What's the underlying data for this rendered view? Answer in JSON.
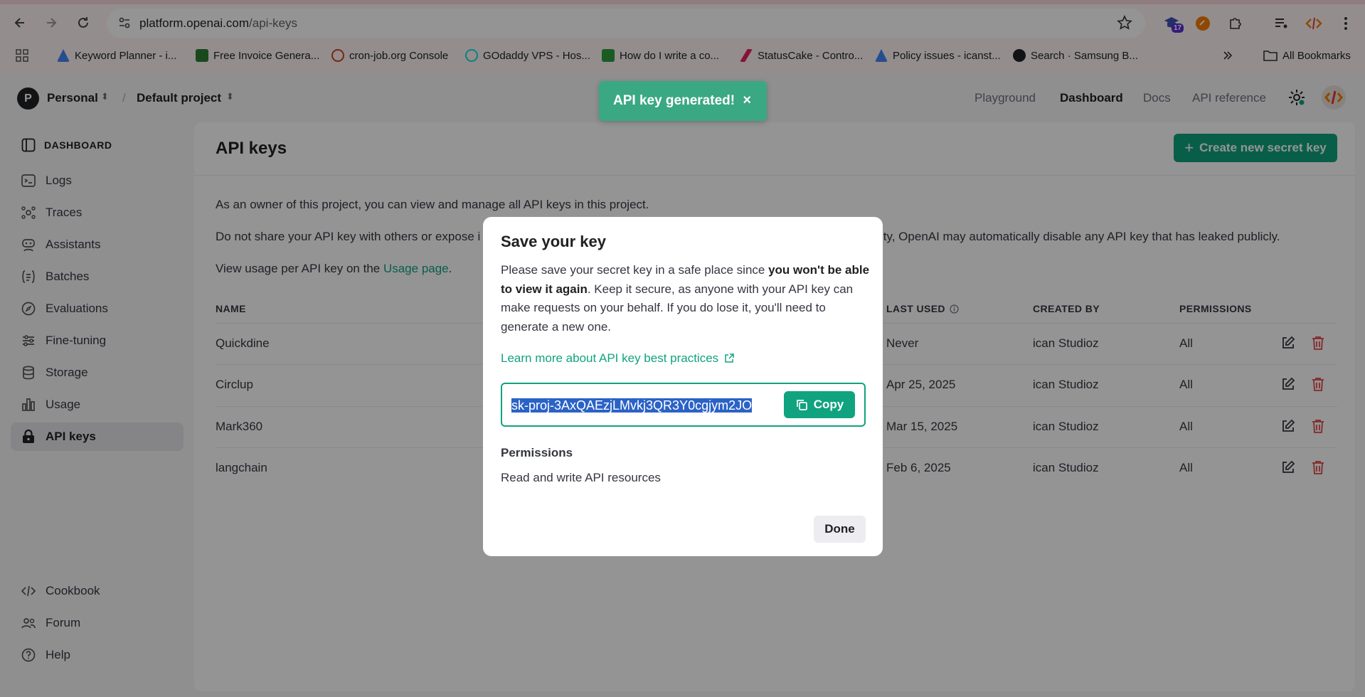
{
  "browser": {
    "url_host": "platform.openai.com",
    "url_path": "/api-keys",
    "extension_badge": "17",
    "bookmarks": [
      {
        "label": "Keyword Planner - i...",
        "color": "#4285f4"
      },
      {
        "label": "Free Invoice Genera...",
        "color": "#2e7d32"
      },
      {
        "label": "cron-job.org Console",
        "color": "#d84315"
      },
      {
        "label": "GOdaddy VPS - Hos...",
        "color": "#1bdbdb"
      },
      {
        "label": "How do I write a co...",
        "color": "#2e9e3e"
      },
      {
        "label": "StatusCake - Contro...",
        "color": "#e91e63"
      },
      {
        "label": "Policy issues - icanst...",
        "color": "#4285f4"
      },
      {
        "label": "Search · Samsung B...",
        "color": "#202124"
      }
    ],
    "all_bookmarks": "All Bookmarks"
  },
  "header": {
    "org_initial": "P",
    "org_name": "Personal",
    "separator": "/",
    "project_name": "Default project",
    "nav": [
      "Playground",
      "Dashboard",
      "Docs",
      "API reference"
    ]
  },
  "sidebar": {
    "heading": "DASHBOARD",
    "items": [
      "Logs",
      "Traces",
      "Assistants",
      "Batches",
      "Evaluations",
      "Fine-tuning",
      "Storage",
      "Usage",
      "API keys"
    ],
    "footer": [
      "Cookbook",
      "Forum",
      "Help"
    ]
  },
  "page": {
    "title": "API keys",
    "create_button": "Create new secret key",
    "line1": "As an owner of this project, you can view and manage all API keys in this project.",
    "line2_start": "Do not share your API key with others or expose i",
    "line2_end": "ity, OpenAI may automatically disable any API key that has leaked publicly.",
    "line3_prefix": "View usage per API key on the ",
    "line3_link": "Usage page",
    "line3_suffix": "."
  },
  "table": {
    "headers": {
      "name": "NAME",
      "last_used": "LAST USED",
      "created_by": "CREATED BY",
      "permissions": "PERMISSIONS"
    },
    "rows": [
      {
        "name": "Quickdine",
        "last_used": "Never",
        "created_by": "ican Studioz",
        "permissions": "All"
      },
      {
        "name": "Circlup",
        "last_used": "Apr 25, 2025",
        "created_by": "ican Studioz",
        "permissions": "All"
      },
      {
        "name": "Mark360",
        "last_used": "Mar 15, 2025",
        "created_by": "ican Studioz",
        "permissions": "All"
      },
      {
        "name": "langchain",
        "last_used": "Feb 6, 2025",
        "created_by": "ican Studioz",
        "permissions": "All"
      }
    ]
  },
  "toast": {
    "message": "API key generated!",
    "close": "×"
  },
  "modal": {
    "title": "Save your key",
    "text_start": "Please save your secret key in a safe place since ",
    "text_bold": "you won't be able to view it again",
    "text_end": ". Keep it secure, as anyone with your API key can make requests on your behalf. If you do lose it, you'll need to generate a new one.",
    "learn_link": "Learn more about API key best practices",
    "key_value": "sk-proj-3AxQAEzjLMvkj3QR3Y0cgjym2JO",
    "copy_label": "Copy",
    "permissions_label": "Permissions",
    "permissions_value": "Read and write API resources",
    "done_label": "Done"
  },
  "colors": {
    "accent": "#10a37f",
    "toast": "#3aa883",
    "delete": "#e5484d",
    "selection": "#2b62c6"
  },
  "icons": [
    "back-icon",
    "forward-icon",
    "reload-icon",
    "site-settings-icon",
    "star-icon",
    "menu-icon",
    "gear-icon",
    "edit-icon",
    "trash-icon",
    "copy-icon",
    "external-link-icon",
    "info-icon"
  ]
}
